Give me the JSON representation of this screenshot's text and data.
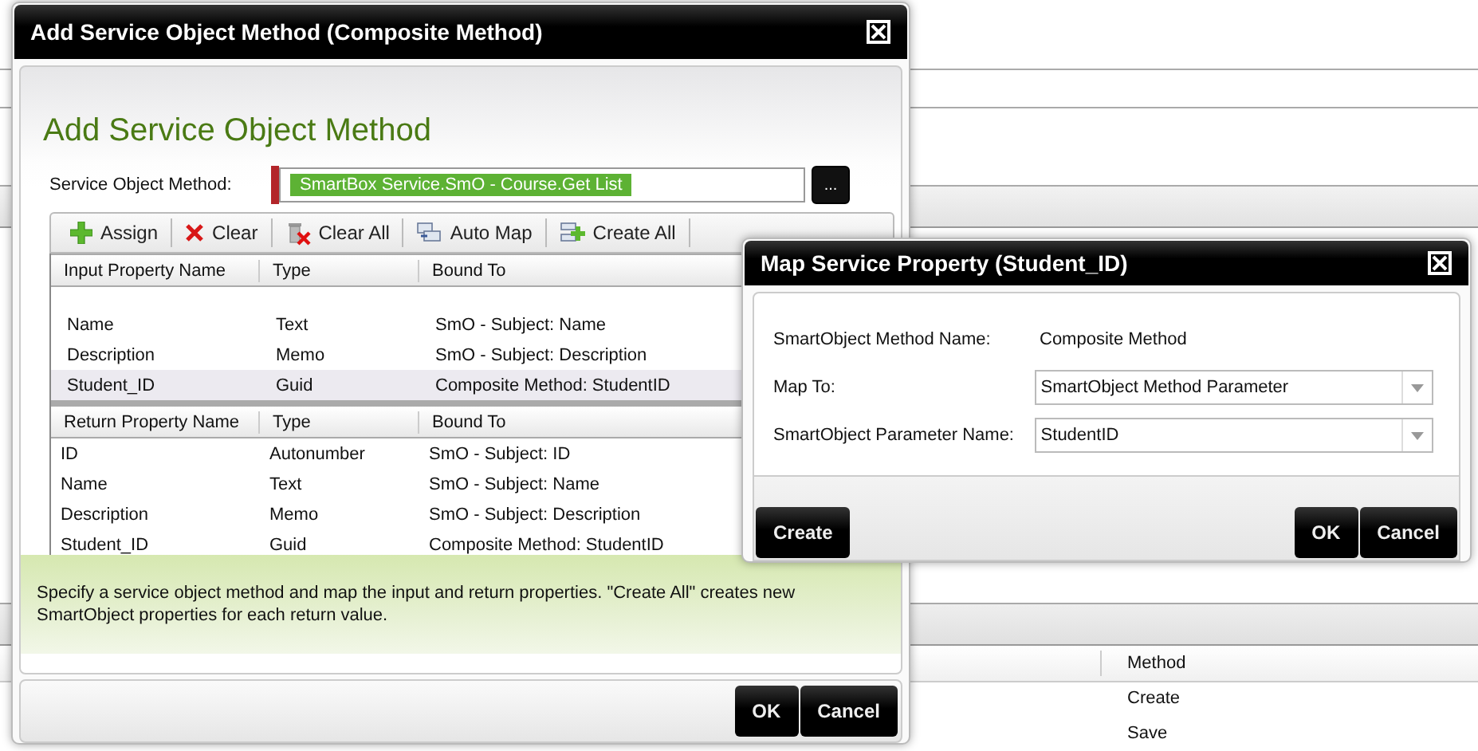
{
  "background": {
    "table": {
      "columns": [
        "Method"
      ],
      "rows": [
        "Create",
        "Save"
      ]
    }
  },
  "main_dialog": {
    "title": "Add Service Object Method (Composite Method)",
    "heading": "Add Service Object Method",
    "method_field": {
      "label": "Service Object Method:",
      "value": "SmartBox Service.SmO - Course.Get List",
      "required": true,
      "browse": "..."
    },
    "toolbar": [
      {
        "kind": "add",
        "label": "Assign"
      },
      {
        "kind": "remove",
        "label": "Clear"
      },
      {
        "kind": "clear_all",
        "label": "Clear All"
      },
      {
        "kind": "auto_map",
        "label": "Auto Map"
      },
      {
        "kind": "create_all",
        "label": "Create All"
      }
    ],
    "input_table": {
      "columns": [
        "Input Property Name",
        "Type",
        "Bound To"
      ],
      "rows": [
        {
          "cells": [
            "Name",
            "Text",
            "SmO - Subject: Name"
          ],
          "selected": false
        },
        {
          "cells": [
            "Description",
            "Memo",
            "SmO - Subject: Description"
          ],
          "selected": false
        },
        {
          "cells": [
            "Student_ID",
            "Guid",
            "Composite Method: StudentID"
          ],
          "selected": true
        }
      ]
    },
    "return_table": {
      "columns": [
        "Return Property Name",
        "Type",
        "Bound To"
      ],
      "rows": [
        {
          "cells": [
            "ID",
            "Autonumber",
            "SmO - Subject: ID"
          ],
          "selected": false
        },
        {
          "cells": [
            "Name",
            "Text",
            "SmO - Subject: Name"
          ],
          "selected": false
        },
        {
          "cells": [
            "Description",
            "Memo",
            "SmO - Subject: Description"
          ],
          "selected": false
        },
        {
          "cells": [
            "Student_ID",
            "Guid",
            "Composite Method: StudentID"
          ],
          "selected": false
        }
      ]
    },
    "info": "Specify a service object method and map the input and return properties. \"Create All\" creates new SmartObject properties for each return value.",
    "buttons": [
      "OK",
      "Cancel"
    ]
  },
  "map_dialog": {
    "title": "Map Service Property (Student_ID)",
    "fields": [
      {
        "kind": "text",
        "label": "SmartObject Method Name:",
        "value": "Composite Method"
      },
      {
        "kind": "select",
        "label": "Map To:",
        "value": "SmartObject Method Parameter"
      },
      {
        "kind": "select",
        "label": "SmartObject Parameter Name:",
        "value": "StudentID"
      }
    ],
    "left_buttons": [
      "Create"
    ],
    "buttons": [
      "OK",
      "Cancel"
    ]
  }
}
